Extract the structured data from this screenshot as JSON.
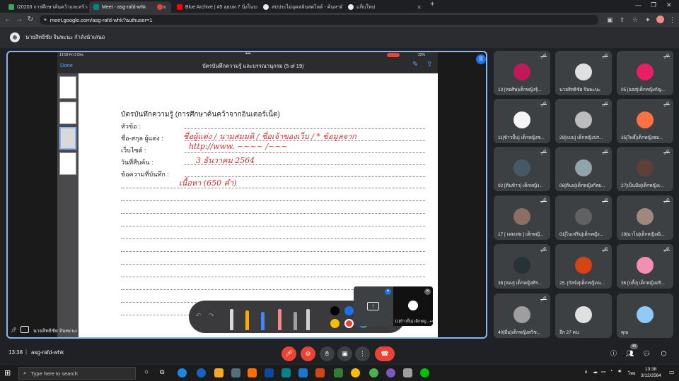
{
  "browser": {
    "tabs": [
      {
        "title": "I20203 การศึกษาค้นคว้าและสร้างองค์",
        "color": "#34a853"
      },
      {
        "title": "Meet - asg-rafd-whk",
        "color": "#00897b",
        "active": true
      },
      {
        "title": "",
        "color": "#ea4335"
      },
      {
        "title": "Blue Archive | #5 ลุยบท 7 นั่งโนบะ",
        "color": "#ff0000"
      },
      {
        "title": "สปประไม่อุดหลินสตไลด์ - ค้นหาด้วย Go",
        "color": "#9aa0a6"
      },
      {
        "title": "แท็บใหม่",
        "color": "#9aa0a6"
      }
    ],
    "new_tab": "+",
    "url": "meet.google.com/asg-rafd-whk?authuser=1"
  },
  "banner": {
    "presenting_text": "นายสิทธิชัย จินพะนะ กำลังนำเสนอ"
  },
  "notes_app": {
    "status_time": "13:58  Fri 3 Dec",
    "status_right": "32%",
    "done": "Done",
    "title": "บัตรบันทึกความรู้ และบรรณานุกรม (5 of 19)",
    "presenter_label": "นายสิทธิชัย จินพะนะ"
  },
  "card": {
    "heading": "บัตรบันทึกความรู้ (การศึกษาค้นคว้าจากอินเตอร์เน็ต)",
    "labels": [
      "หัวข้อ :",
      "ชื่อ-สกุล ผู้แต่ง :",
      "เว็บไซต์ :",
      "วันที่สืบค้น :",
      "ข้อความที่บันทึก :"
    ],
    "handwriting": [
      "ชื่อผู้แต่ง / นามสมมติ / ชื่อเจ้าของเว็บ / * ข้อมูลจาก",
      "http://www. ~~~~ /~~~",
      "3 ธันวาคม 2564",
      "เนื้อหา (650 คำ)"
    ]
  },
  "share_popup": {
    "label": "11[ข้าวปั้น] เด็กหญ...+43"
  },
  "participants": [
    {
      "name": "13 [หอศิษ]เด็กหญิงรุ้...",
      "color": "#c2185b"
    },
    {
      "name": "นายสิทธิชัย จินพะนะ",
      "color": "#e0e0e0"
    },
    {
      "name": "05 [ออส]เด็กหญิงกัญ...",
      "color": "#e91e63"
    },
    {
      "name": "11[ข้าวปั้น] เด็กหญิงช...",
      "color": "#f5f5f5"
    },
    {
      "name": "29[แบบ] เด็กหญิงปร...",
      "color": "#bdbdbd"
    },
    {
      "name": "35[โพธิ์]เด็กหญิงธม...",
      "color": "#ff7043"
    },
    {
      "name": "02 [ต้นข้าว] เด็กหญิง...",
      "color": "#455a64"
    },
    {
      "name": "06[ต้นม]เด็กหญิงกัลย...",
      "color": "#90a4ae"
    },
    {
      "name": "27[เป็นมีย]เด็กหญิงเ...",
      "color": "#5d4037"
    },
    {
      "name": "17 [ เพ่ยเฟย ] เด็กหญิ...",
      "color": "#8d6e63"
    },
    {
      "name": "01[ไนเฟริน]เด็กหญิง...",
      "color": "#616161"
    },
    {
      "name": "19[นาโน]เด็กหญิงณิ...",
      "color": "#a1887f"
    },
    {
      "name": "38 [ลอง] เด็กหญิงศิร...",
      "color": "#263238"
    },
    {
      "name": "25. [กัสจัง]เด็กหญิงณ...",
      "color": "#d84315"
    },
    {
      "name": "36 [บลิ้ง] เด็กหญิงอริ...",
      "color": "#f48fb1"
    },
    {
      "name": "40[มีม]เด็กหญิงสวิช...",
      "color": "#9e9e9e"
    },
    {
      "name": "อีก 27 คน",
      "color": "#e0e0e0"
    },
    {
      "name": "คุณ",
      "color": "#90caf9"
    }
  ],
  "meeting": {
    "time": "13:38",
    "code": "asg-rafd-whk",
    "people_badge": "45"
  },
  "taskbar": {
    "search_placeholder": "Type here to search",
    "clock": "13:38",
    "date": "3/12/2564",
    "lang": "ไทย"
  },
  "colors": {
    "accent": "#8ab4f8",
    "red": "#ea4335",
    "ink": "#d32f2f"
  }
}
